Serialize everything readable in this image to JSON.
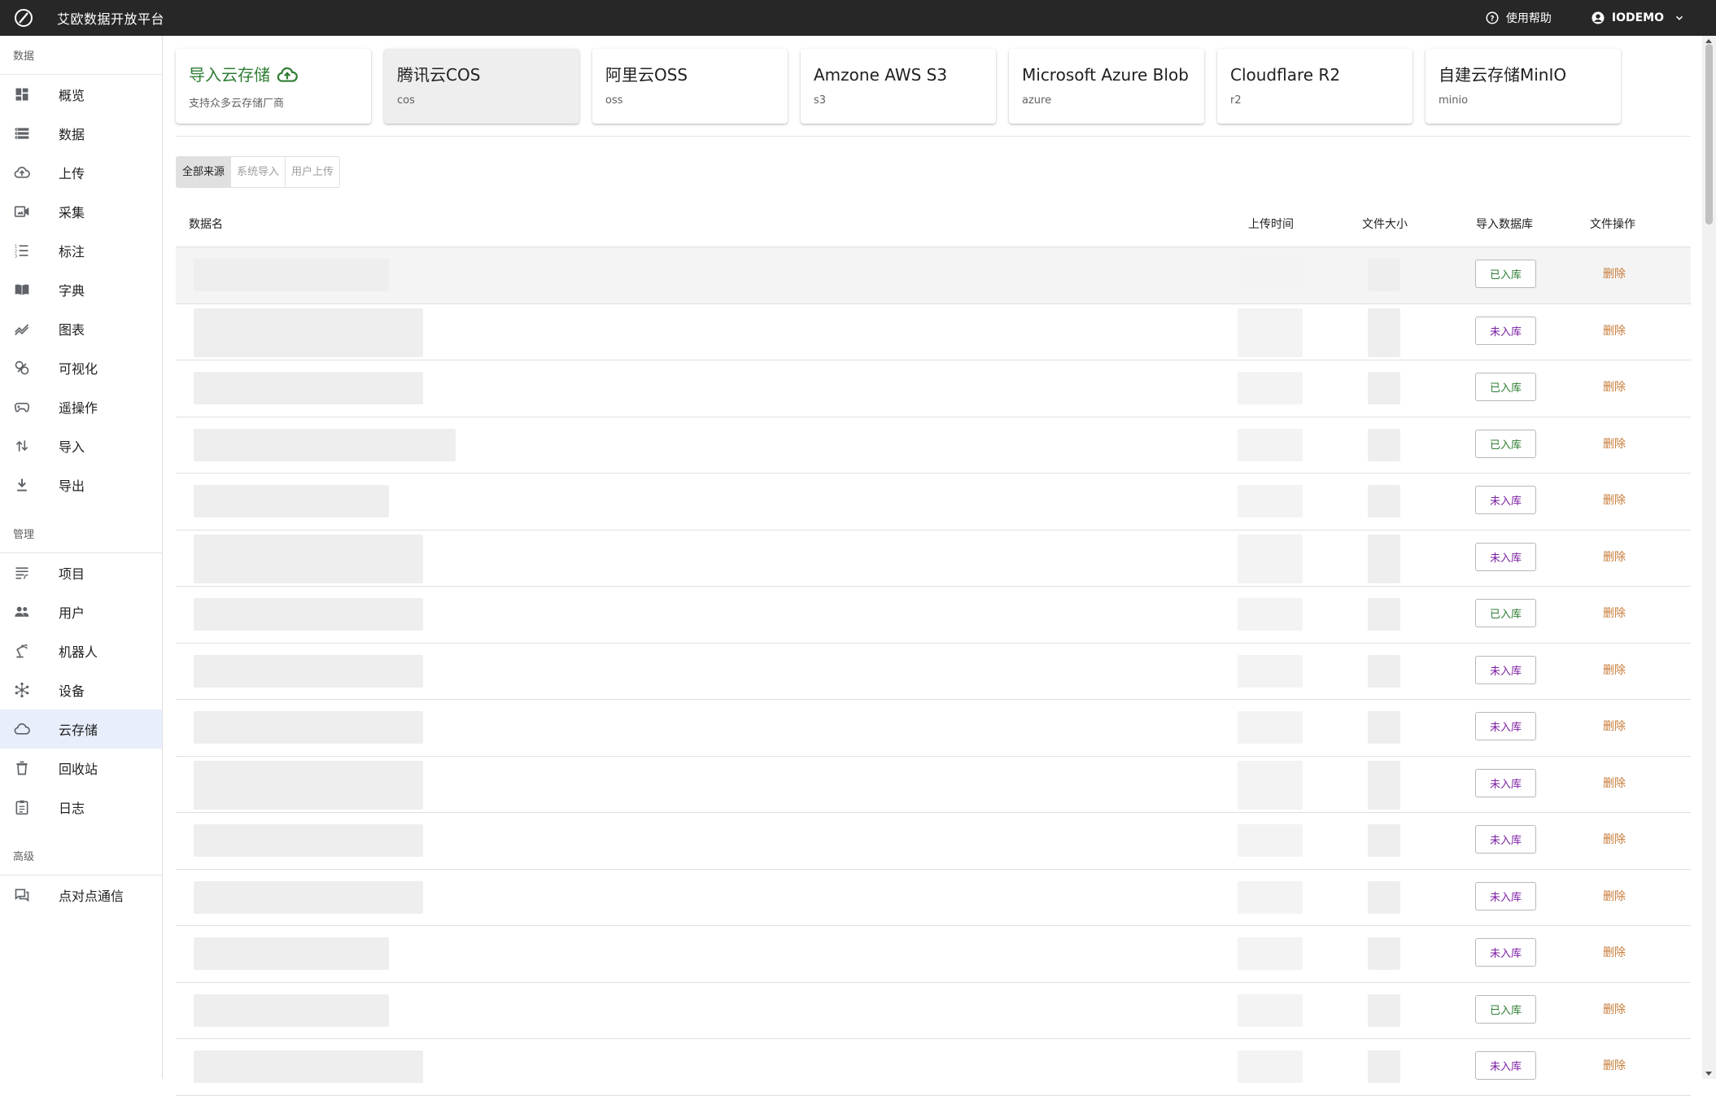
{
  "app": {
    "title": "艾欧数据开放平台",
    "help_label": "使用帮助",
    "user_label": "IODEMO"
  },
  "sidebar": {
    "sections": [
      {
        "title": "数据",
        "items": [
          {
            "label": "概览",
            "icon": "dashboard-icon"
          },
          {
            "label": "数据",
            "icon": "storage-icon"
          },
          {
            "label": "上传",
            "icon": "cloud-upload-icon"
          },
          {
            "label": "采集",
            "icon": "camera-icon"
          },
          {
            "label": "标注",
            "icon": "list-icon"
          },
          {
            "label": "字典",
            "icon": "book-icon"
          },
          {
            "label": "图表",
            "icon": "chart-icon"
          },
          {
            "label": "可视化",
            "icon": "visualize-icon"
          },
          {
            "label": "遥操作",
            "icon": "gamepad-icon"
          },
          {
            "label": "导入",
            "icon": "import-arrows-icon"
          },
          {
            "label": "导出",
            "icon": "download-icon"
          }
        ]
      },
      {
        "title": "管理",
        "items": [
          {
            "label": "项目",
            "icon": "project-icon"
          },
          {
            "label": "用户",
            "icon": "users-icon"
          },
          {
            "label": "机器人",
            "icon": "robot-arm-icon"
          },
          {
            "label": "设备",
            "icon": "device-hub-icon"
          },
          {
            "label": "云存储",
            "icon": "cloud-icon",
            "active": true
          },
          {
            "label": "回收站",
            "icon": "trash-icon"
          },
          {
            "label": "日志",
            "icon": "log-icon"
          }
        ]
      },
      {
        "title": "高级",
        "items": [
          {
            "label": "点对点通信",
            "icon": "chat-icon"
          }
        ]
      }
    ]
  },
  "providers": [
    {
      "title": "导入云存储",
      "sub": "支持众多云存储厂商",
      "type": "import"
    },
    {
      "title": "腾讯云COS",
      "sub": "cos",
      "selected": true
    },
    {
      "title": "阿里云OSS",
      "sub": "oss"
    },
    {
      "title": "Amzone AWS S3",
      "sub": "s3"
    },
    {
      "title": "Microsoft Azure Blob",
      "sub": "azure"
    },
    {
      "title": "Cloudflare R2",
      "sub": "r2"
    },
    {
      "title": "自建云存储MinIO",
      "sub": "minio"
    }
  ],
  "filters": [
    {
      "label": "全部来源",
      "active": true
    },
    {
      "label": "系统导入"
    },
    {
      "label": "用户上传"
    }
  ],
  "table": {
    "headers": {
      "name": "数据名",
      "time": "上传时间",
      "size": "文件大小",
      "import": "导入数据库",
      "ops": "文件操作"
    },
    "delete_label": "删除",
    "status_in": "已入库",
    "status_out": "未入库",
    "rows": [
      {
        "status": "已入库"
      },
      {
        "status": "未入库"
      },
      {
        "status": "已入库"
      },
      {
        "status": "已入库"
      },
      {
        "status": "未入库"
      },
      {
        "status": "未入库"
      },
      {
        "status": "已入库"
      },
      {
        "status": "未入库"
      },
      {
        "status": "未入库"
      },
      {
        "status": "未入库"
      },
      {
        "status": "未入库"
      },
      {
        "status": "未入库"
      },
      {
        "status": "未入库"
      },
      {
        "status": "已入库"
      },
      {
        "status": "未入库"
      }
    ]
  },
  "colors": {
    "topbar": "#272727",
    "accent_green": "#2e7d32",
    "status_out": "#7b1fa2",
    "delete": "#c77b38",
    "active_nav": "#e8eefb"
  }
}
